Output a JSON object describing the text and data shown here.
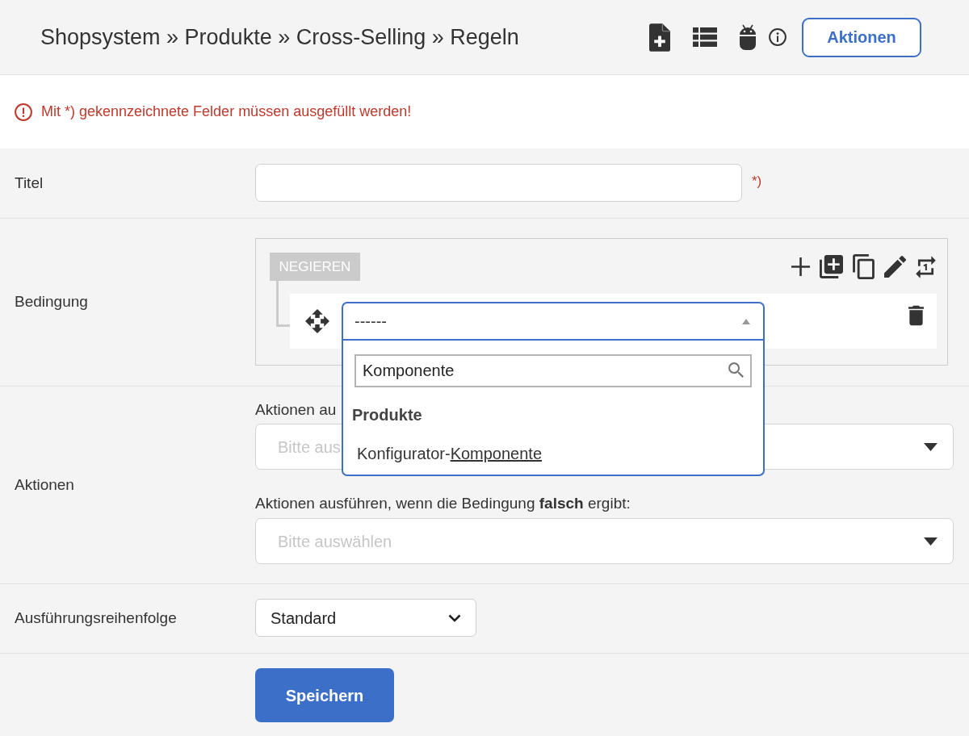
{
  "header": {
    "breadcrumb": "Shopsystem » Produkte » Cross-Selling » Regeln",
    "actions_button": "Aktionen"
  },
  "alert": {
    "text": "Mit *) gekennzeichnete Felder müssen ausgefüllt werden!"
  },
  "title_field": {
    "label": "Titel",
    "required_mark": "*)"
  },
  "condition": {
    "label": "Bedingung",
    "negate": {
      "label": "NEGIEREN",
      "on": false
    },
    "rule": {
      "value": "------",
      "expanded": true,
      "search": "Komponente",
      "groups": [
        {
          "label": "Produkte",
          "options": [
            {
              "before": "Konfigurator-",
              "match": "Komponente",
              "selected": false
            }
          ]
        }
      ]
    }
  },
  "actions": {
    "label": "Aktionen",
    "fields": [
      {
        "label": "Aktionen au",
        "placeholder": "Bitte aus"
      },
      {
        "label": "Aktionen ausführen, wenn die Bedingung **falsch** ergibt:",
        "placeholder": "Bitte auswählen"
      }
    ]
  },
  "order": {
    "label": "Ausführungsreihenfolge",
    "value": "Standard"
  },
  "save_button": "Speichern"
}
